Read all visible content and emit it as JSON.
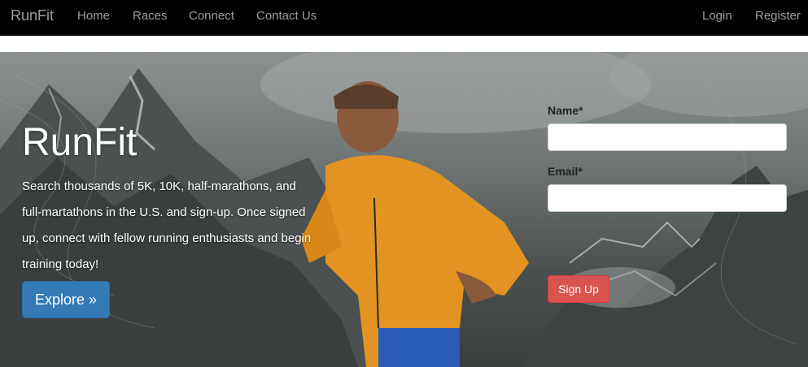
{
  "navbar": {
    "brand": "RunFit",
    "links": [
      "Home",
      "Races",
      "Connect",
      "Contact Us"
    ],
    "right_links": [
      "Login",
      "Register"
    ],
    "background": "#000000",
    "text_color": "#9d9d9d"
  },
  "hero": {
    "title": "RunFit",
    "description_lines": [
      "Search thousands of 5K, 10K, half-marathons, and",
      "full-martathons in the U.S. and sign-up. Once signed",
      "up, connect with fellow running enthusiasts and begin",
      "training today!"
    ],
    "explore_label": "Explore »",
    "explore_color": "#337ab7"
  },
  "signup_form": {
    "name_label": "Name*",
    "name_value": "",
    "email_label": "Email*",
    "email_value": "",
    "submit_label": "Sign Up",
    "submit_color": "#d9534f"
  }
}
